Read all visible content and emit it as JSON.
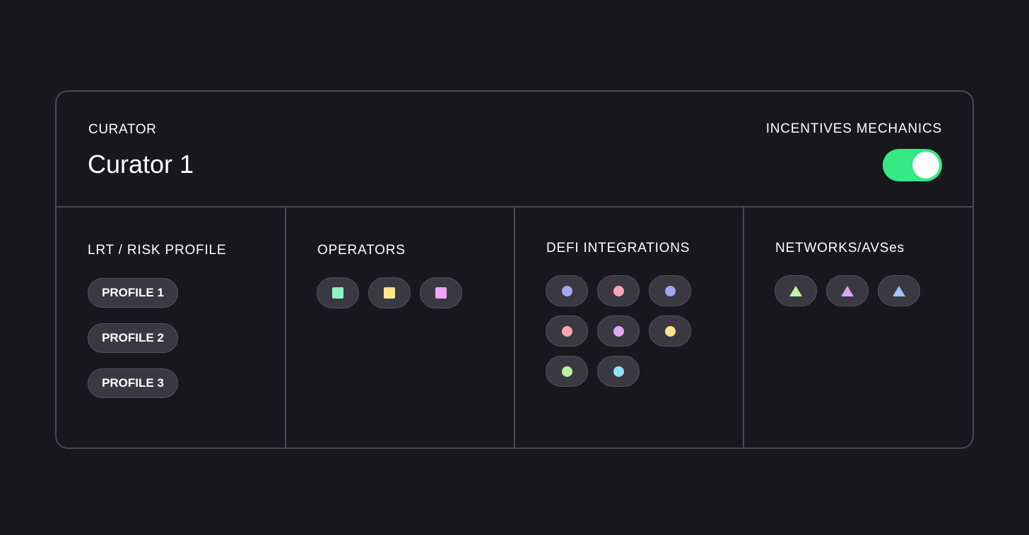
{
  "header": {
    "curator_label": "CURATOR",
    "curator_name": "Curator 1",
    "incentives_label": "INCENTIVES MECHANICS",
    "incentives_enabled": true,
    "toggle_color": "#35e985"
  },
  "columns": {
    "risk": {
      "title": "LRT / RISK PROFILE",
      "profiles": [
        "PROFILE 1",
        "PROFILE 2",
        "PROFILE 3"
      ]
    },
    "operators": {
      "title": "OPERATORS",
      "items": [
        {
          "icon": "square-icon",
          "color": "#8ef0c4"
        },
        {
          "icon": "square-icon",
          "color": "#fde68a"
        },
        {
          "icon": "square-icon",
          "color": "#f0a6f7"
        }
      ]
    },
    "defi": {
      "title": "DEFI INTEGRATIONS",
      "items": [
        {
          "icon": "dot-icon",
          "color": "#a5a6f6"
        },
        {
          "icon": "dot-icon",
          "color": "#fca5b4"
        },
        {
          "icon": "dot-icon",
          "color": "#a5a6f6"
        },
        {
          "icon": "dot-icon",
          "color": "#fca5b4"
        },
        {
          "icon": "dot-icon",
          "color": "#e3a6f7"
        },
        {
          "icon": "dot-icon",
          "color": "#fde68a"
        },
        {
          "icon": "dot-icon",
          "color": "#b8f2a0"
        },
        {
          "icon": "dot-icon",
          "color": "#8fe3f5"
        }
      ]
    },
    "networks": {
      "title": "NETWORKS/AVSes",
      "items": [
        {
          "icon": "triangle-icon",
          "color": "#c3f5a3"
        },
        {
          "icon": "triangle-icon",
          "color": "#d8a6f7"
        },
        {
          "icon": "triangle-icon",
          "color": "#9fc4f8"
        }
      ]
    }
  }
}
